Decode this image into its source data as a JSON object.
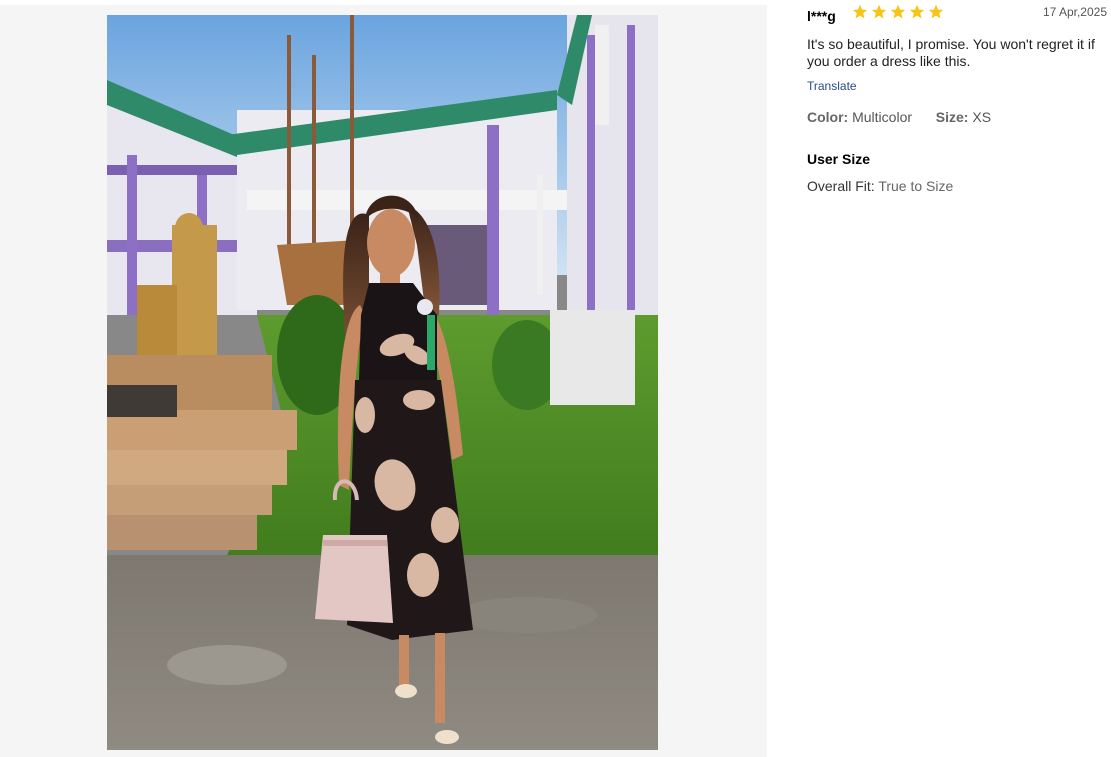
{
  "review": {
    "username": "l***g",
    "rating": 5,
    "rating_max": 5,
    "star_color": "#f7c518",
    "date": "17 Apr,2025",
    "text": "It's so beautiful, I promise. You won't regret it if you order a dress like this.",
    "translate_label": "Translate",
    "color_label": "Color:",
    "color_value": "Multicolor",
    "size_label": "Size:",
    "size_value": "XS",
    "user_size_title": "User Size",
    "fit_label": "Overall Fit:",
    "fit_value": "True to Size"
  },
  "photo": {
    "subject": "customer-photo-woman-in-floral-halter-dress"
  }
}
